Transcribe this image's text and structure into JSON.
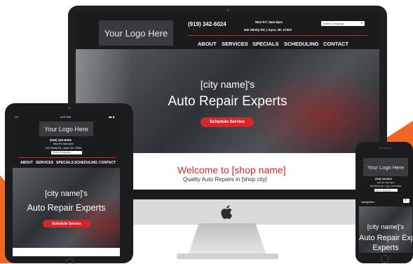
{
  "brand": {
    "accent": "#f26522",
    "cta_color": "#d7262b",
    "welcome_color": "#d7262b"
  },
  "site": {
    "logo": "Your Logo Here",
    "phone": "(919) 342-6024",
    "hours": "Mon-Fri: 8am-6pm",
    "address": "942 Windy Rd. | Apex, NC 27502",
    "language": "Select Language",
    "nav": [
      "ABOUT",
      "SERVICES",
      "SPECIALS",
      "SCHEDULING",
      "CONTACT"
    ],
    "hero_line1": "[city name]'s",
    "hero_line2": "Auto Repair Experts",
    "cta": "Schedule Service",
    "welcome_title": "Welcome to [shop name]",
    "welcome_sub": "Quality Auto Repairs in [shop city]"
  },
  "ipad": {
    "status_left": "••ll",
    "status_time": "4:20 PM",
    "status_right": "■■ ▮"
  },
  "iphone": {
    "navigation_label": "Navigation",
    "hero_line3": "Experts"
  },
  "icons": {
    "apple": "apple-logo-icon",
    "menu": "menu-icon",
    "camera": "camera-icon"
  }
}
